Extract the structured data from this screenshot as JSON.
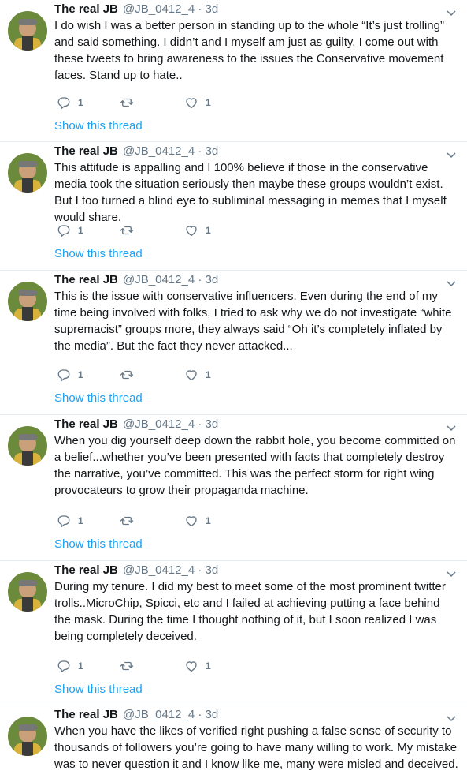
{
  "tweets": [
    {
      "name": "The real JB",
      "handle": "@JB_0412_4 · 3d",
      "text": "I do wish I was a better person in standing up to the whole “It’s just trolling” and said something. I didn’t and I myself am just as guilty, I come out with these tweets to bring awareness to the issues the Conservative movement faces. Stand up to hate..",
      "reply_count": "1",
      "retweet_count": "",
      "like_count": "1",
      "show_thread": "Show this thread"
    },
    {
      "name": "The real JB",
      "handle": "@JB_0412_4 · 3d",
      "text": "This attitude is appalling and I 100% believe if those in the conservative media took the situation seriously then maybe these groups wouldn’t exist. But I too turned a blind eye to subliminal messaging in memes that I myself would share.",
      "reply_count": "1",
      "retweet_count": "",
      "like_count": "1",
      "show_thread": "Show this thread"
    },
    {
      "name": "The real JB",
      "handle": "@JB_0412_4 · 3d",
      "text": "This is the issue with conservative influencers. Even during the end of my time being involved with folks, I tried to ask why we do not investigate “white supremacist” groups more, they always said “Oh it’s completely inflated by the media”. But the fact they never attacked...",
      "reply_count": "1",
      "retweet_count": "",
      "like_count": "1",
      "show_thread": "Show this thread"
    },
    {
      "name": "The real JB",
      "handle": "@JB_0412_4 · 3d",
      "text": "When you dig yourself deep down the rabbit hole, you become committed on a belief...whether you’ve been presented with facts that completely destroy the narrative, you’ve committed. This was the perfect storm for right wing provocateurs to grow their propaganda machine.",
      "reply_count": "1",
      "retweet_count": "",
      "like_count": "1",
      "show_thread": "Show this thread"
    },
    {
      "name": "The real JB",
      "handle": "@JB_0412_4 · 3d",
      "text": "During my tenure. I did my best to meet some of the most prominent twitter trolls..MicroChip, Spicci, etc and I failed at achieving putting a face behind the mask. During the time I thought nothing of it, but I soon realized I was being completely deceived.",
      "reply_count": "1",
      "retweet_count": "",
      "like_count": "1",
      "show_thread": "Show this thread"
    },
    {
      "name": "The real JB",
      "handle": "@JB_0412_4 · 3d",
      "text": "When you have the likes of verified right pushing a false sense of security to thousands of followers you’re going to have many willing to work. My mistake was to never question it and I know like me, many were misled and deceived."
    }
  ],
  "icons": {
    "reply": "reply-icon",
    "retweet": "retweet-icon",
    "like": "like-icon",
    "caret": "chevron-down-icon"
  },
  "colors": {
    "link": "#1da1f2",
    "secondary_text": "#657786",
    "divider": "#e6ecf0"
  }
}
